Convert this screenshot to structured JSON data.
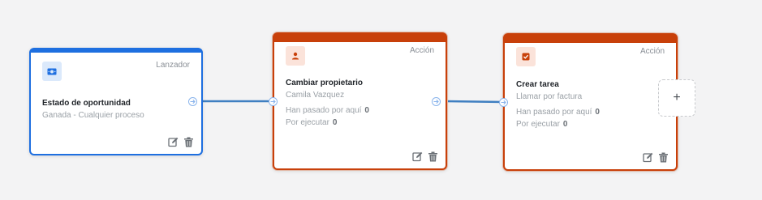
{
  "nodes": [
    {
      "kind": "Lanzador",
      "icon": "money-icon",
      "title": "Estado de oportunidad",
      "subtitle": "Ganada - Cualquier proceso"
    },
    {
      "kind": "Acción",
      "icon": "person-icon",
      "title": "Cambiar propietario",
      "subtitle": "Camila Vazquez",
      "passed_label": "Han pasado por aquí",
      "passed_value": "0",
      "pending_label": "Por ejecutar",
      "pending_value": "0"
    },
    {
      "kind": "Acción",
      "icon": "checkbox-icon",
      "title": "Crear tarea",
      "subtitle": "Llamar por factura",
      "passed_label": "Han pasado por aquí",
      "passed_value": "0",
      "pending_label": "Por ejecutar",
      "pending_value": "0"
    }
  ],
  "add_button": {
    "label": "+"
  },
  "colors": {
    "trigger": "#1e6fe0",
    "action": "#c8400a",
    "connector": "#3f7fc1"
  }
}
